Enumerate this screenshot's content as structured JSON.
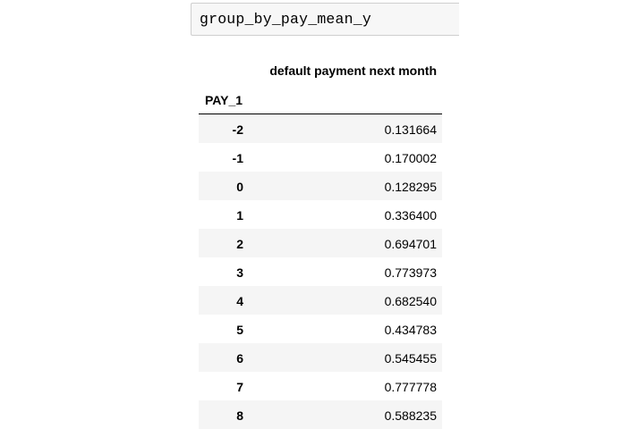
{
  "code_cell": {
    "text": "group_by_pay_mean_y"
  },
  "dataframe": {
    "column_header": "default payment next month",
    "index_name": "PAY_1",
    "rows": [
      {
        "index": "-2",
        "value": "0.131664"
      },
      {
        "index": "-1",
        "value": "0.170002"
      },
      {
        "index": "0",
        "value": "0.128295"
      },
      {
        "index": "1",
        "value": "0.336400"
      },
      {
        "index": "2",
        "value": "0.694701"
      },
      {
        "index": "3",
        "value": "0.773973"
      },
      {
        "index": "4",
        "value": "0.682540"
      },
      {
        "index": "5",
        "value": "0.434783"
      },
      {
        "index": "6",
        "value": "0.545455"
      },
      {
        "index": "7",
        "value": "0.777778"
      },
      {
        "index": "8",
        "value": "0.588235"
      }
    ]
  }
}
